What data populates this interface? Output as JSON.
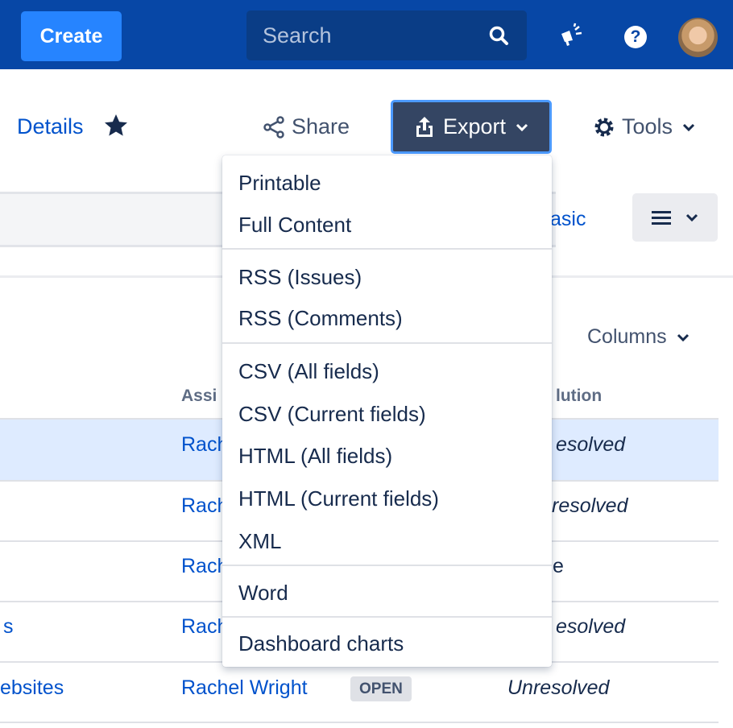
{
  "topbar": {
    "create_label": "Create",
    "search_placeholder": "Search",
    "icons": [
      "search-icon",
      "feedback-icon",
      "help-icon",
      "avatar"
    ],
    "help_glyph": "?"
  },
  "header": {
    "details_label": "Details",
    "share_label": "Share",
    "export_label": "Export",
    "tools_label": "Tools"
  },
  "filter": {
    "basic_label": "asic"
  },
  "table": {
    "columns_label": "Columns",
    "headers": {
      "assignee": "Assi",
      "resolution": "lution"
    },
    "rows": [
      {
        "summary": "",
        "assignee": "Rach",
        "resolution": "esolved"
      },
      {
        "summary": "",
        "assignee": "Rach",
        "resolution": "resolved"
      },
      {
        "summary": "",
        "assignee": "Rach",
        "resolution": "e"
      },
      {
        "summary": "s",
        "assignee": "Rach",
        "resolution": "esolved"
      },
      {
        "summary": "ebsites",
        "assignee": "Rachel Wright",
        "status": "OPEN",
        "resolution": "Unresolved"
      }
    ]
  },
  "export_menu": {
    "groups": [
      [
        "Printable",
        "Full Content"
      ],
      [
        "RSS (Issues)",
        "RSS (Comments)"
      ],
      [
        "CSV (All fields)",
        "CSV (Current fields)",
        "HTML (All fields)",
        "HTML (Current fields)",
        "XML"
      ],
      [
        "Word"
      ],
      [
        "Dashboard charts"
      ]
    ]
  },
  "colors": {
    "nav_bg": "#0747a6",
    "create_bg": "#2684ff",
    "export_bg": "#344563",
    "link": "#0052cc",
    "selected_row": "#deebff"
  }
}
